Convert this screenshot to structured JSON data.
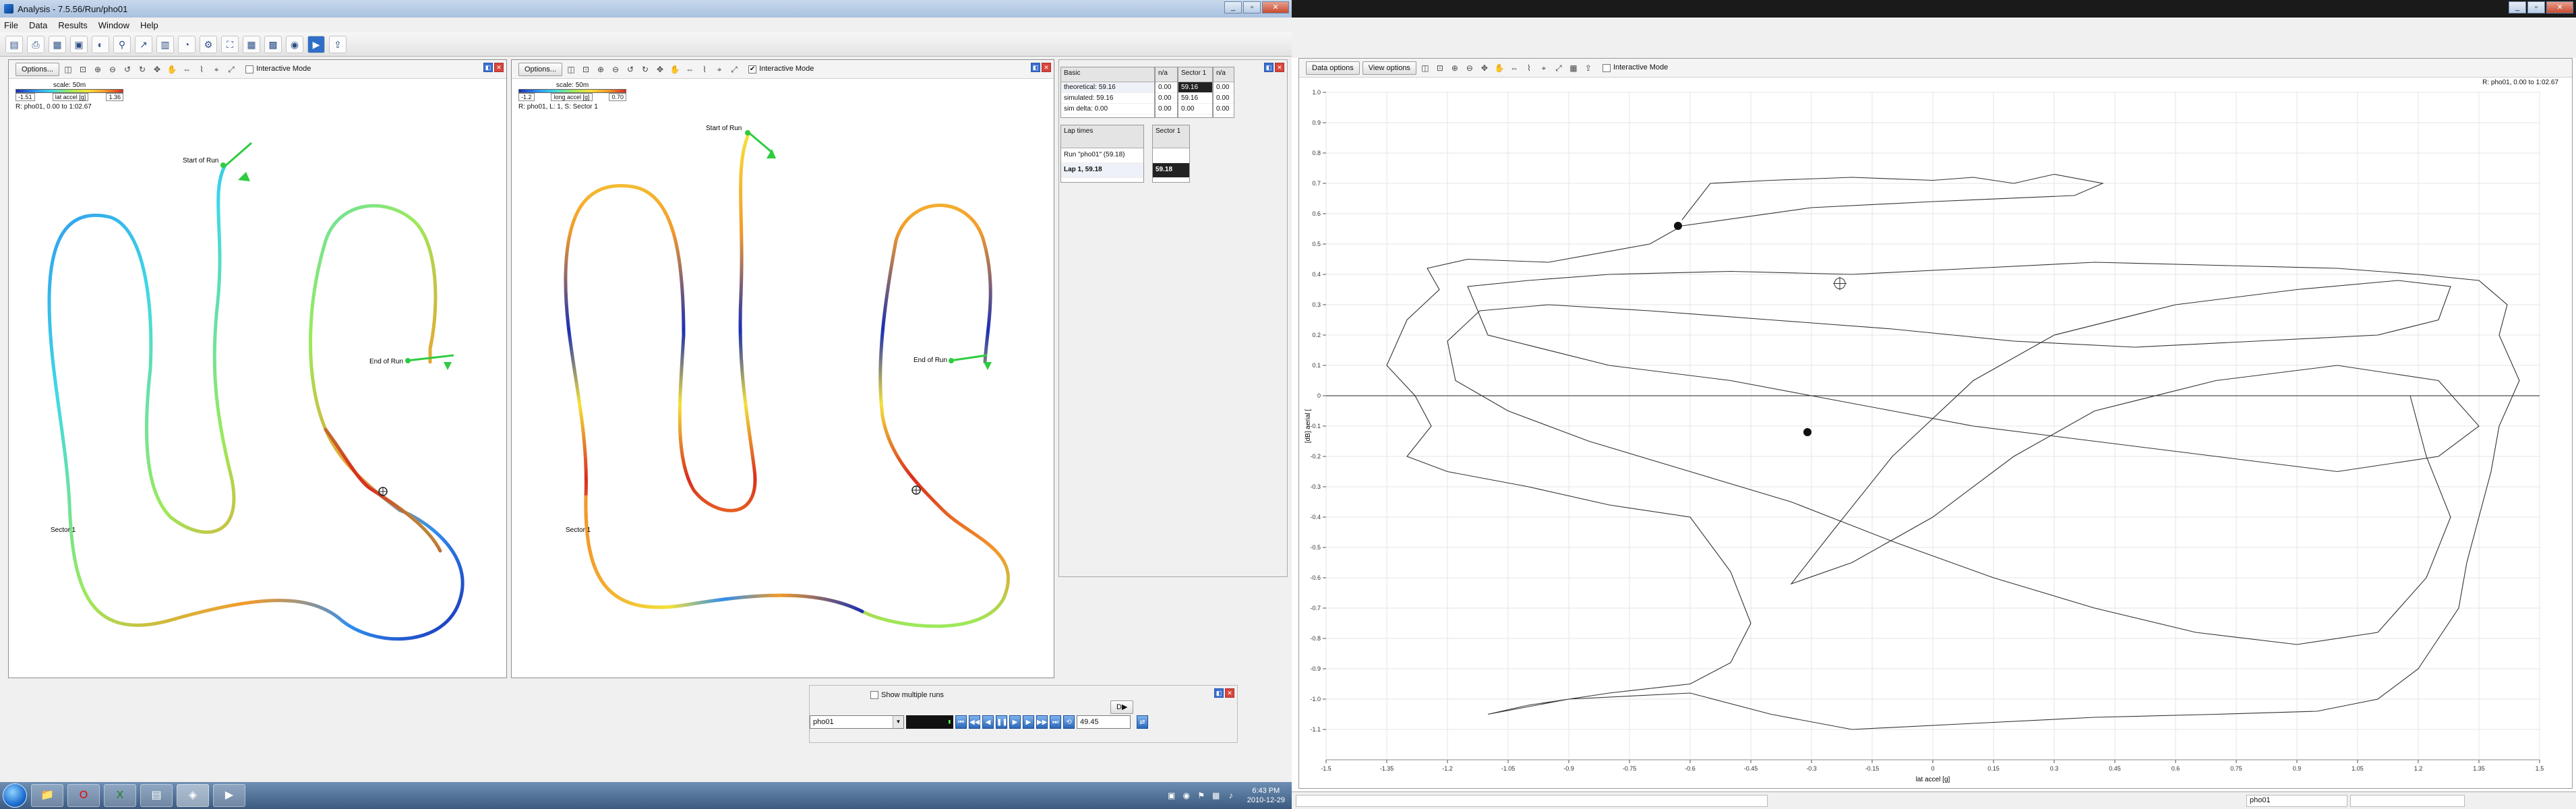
{
  "app": {
    "title": "Analysis - 7.5.56/Run/pho01",
    "menu": [
      "File",
      "Data",
      "Results",
      "Window",
      "Help"
    ]
  },
  "track_left": {
    "options_label": "Options...",
    "interactive_label": "Interactive Mode",
    "interactive_checked": false,
    "scale": "scale: 50m",
    "legend_min": "-1.51",
    "legend_channel": "lat accel [g]",
    "legend_max": "1.36",
    "info": "R: pho01, 0.00 to 1:02.67",
    "start_label": "Start of Run",
    "end_label": "End of Run",
    "sector_label": "Sector 1"
  },
  "track_mid": {
    "options_label": "Options...",
    "interactive_label": "Interactive Mode",
    "interactive_checked": true,
    "scale": "scale: 50m",
    "legend_min": "-1.2",
    "legend_channel": "long accel [g]",
    "legend_max": "0.70",
    "info": "R: pho01, L: 1, S: Sector 1",
    "start_label": "Start of Run",
    "end_label": "End of Run",
    "sector_label": "Sector 1"
  },
  "sectors_table": {
    "col_basic": "Basic",
    "col_nb": "n/a",
    "col_sector": "Sector 1",
    "col_nb2": "n/a",
    "rows": [
      {
        "label": "theoretical: 59.16",
        "nb": "0.00",
        "val": "59.16",
        "nb2": "0.00"
      },
      {
        "label": "simulated: 59.16",
        "nb": "0.00",
        "val": "59.16",
        "nb2": "0.00"
      },
      {
        "label": "sim delta: 0.00",
        "nb": "0.00",
        "val": "0.00",
        "nb2": "0.00"
      }
    ]
  },
  "laps_table": {
    "col_laps": "Lap times",
    "col_sector": "Sector 1",
    "run_label": "Run \"pho01\" (59.18)",
    "lap_label": "Lap 1, 59.18",
    "lap_sector": "59.18"
  },
  "playback": {
    "show_multiple_label": "Show multiple runs",
    "run_select": "pho01",
    "time": "49.45",
    "dp_label": "D▶"
  },
  "taskbar": {
    "time": "6:43 PM",
    "date": "2010-12-29"
  },
  "scatter_window": {
    "data_options_label": "Data options",
    "view_options_label": "View options",
    "interactive_label": "Interactive Mode",
    "info": "R: pho01, 0.00 to 1:02.67",
    "x_label": "lat accel [g]",
    "y_label": "[dB] aerial ["
  },
  "chart_data": {
    "type": "scatter",
    "x_label": "lat accel [g]",
    "y_label": "[dB] aerial [",
    "xlim": [
      -1.5,
      1.5
    ],
    "ylim": [
      -1.2,
      1.0
    ],
    "x_ticks": [
      "-1.5",
      "-1.35",
      "-1.2",
      "-1.05",
      "-0.9",
      "-0.75",
      "-0.6",
      "-0.45",
      "-0.3",
      "-0.15",
      "0",
      "0.15",
      "0.3",
      "0.45",
      "0.6",
      "0.75",
      "0.9",
      "1.05",
      "1.2",
      "1.35",
      "1.5"
    ],
    "y_ticks": [
      "1.0",
      "0.9",
      "0.8",
      "0.7",
      "0.6",
      "0.5",
      "0.4",
      "0.3",
      "0.2",
      "0.1",
      "0",
      "-0.1",
      "-0.2",
      "-0.3",
      "-0.4",
      "-0.5",
      "-0.6",
      "-0.7",
      "-0.8",
      "-0.9",
      "-1.0",
      "-1.1"
    ],
    "markers": [
      {
        "x": -0.63,
        "y": 0.56
      },
      {
        "x": -0.31,
        "y": -0.12
      }
    ],
    "cursor": {
      "x": -0.23,
      "y": 0.37
    },
    "trace": [
      [
        -0.62,
        0.58
      ],
      [
        -0.55,
        0.7
      ],
      [
        -0.4,
        0.71
      ],
      [
        -0.2,
        0.72
      ],
      [
        0.0,
        0.71
      ],
      [
        0.1,
        0.72
      ],
      [
        0.2,
        0.7
      ],
      [
        0.3,
        0.73
      ],
      [
        0.42,
        0.7
      ],
      [
        0.35,
        0.66
      ],
      [
        0.0,
        0.64
      ],
      [
        -0.3,
        0.62
      ],
      [
        -0.62,
        0.56
      ],
      [
        -0.7,
        0.5
      ],
      [
        -0.95,
        0.44
      ],
      [
        -1.15,
        0.45
      ],
      [
        -1.25,
        0.42
      ],
      [
        -1.22,
        0.35
      ],
      [
        -1.3,
        0.25
      ],
      [
        -1.35,
        0.1
      ],
      [
        -1.28,
        0.0
      ],
      [
        -1.24,
        -0.1
      ],
      [
        -1.3,
        -0.2
      ],
      [
        -1.2,
        -0.25
      ],
      [
        -1.0,
        -0.3
      ],
      [
        -0.8,
        -0.36
      ],
      [
        -0.6,
        -0.4
      ],
      [
        -0.5,
        -0.58
      ],
      [
        -0.45,
        -0.75
      ],
      [
        -0.5,
        -0.88
      ],
      [
        -0.6,
        -0.95
      ],
      [
        -0.8,
        -0.98
      ],
      [
        -1.0,
        -1.02
      ],
      [
        -1.1,
        -1.05
      ],
      [
        -0.9,
        -1.0
      ],
      [
        -0.6,
        -0.98
      ],
      [
        -0.4,
        -1.05
      ],
      [
        -0.2,
        -1.1
      ],
      [
        0.1,
        -1.08
      ],
      [
        0.4,
        -1.06
      ],
      [
        0.7,
        -1.05
      ],
      [
        0.95,
        -1.04
      ],
      [
        1.1,
        -1.0
      ],
      [
        1.2,
        -0.9
      ],
      [
        1.3,
        -0.7
      ],
      [
        1.32,
        -0.55
      ],
      [
        1.35,
        -0.4
      ],
      [
        1.38,
        -0.25
      ],
      [
        1.4,
        -0.1
      ],
      [
        1.45,
        0.05
      ],
      [
        1.4,
        0.2
      ],
      [
        1.42,
        0.3
      ],
      [
        1.35,
        0.38
      ],
      [
        1.2,
        0.4
      ],
      [
        1.0,
        0.42
      ],
      [
        0.7,
        0.43
      ],
      [
        0.4,
        0.44
      ],
      [
        0.1,
        0.42
      ],
      [
        -0.2,
        0.4
      ],
      [
        -0.5,
        0.41
      ],
      [
        -0.8,
        0.4
      ],
      [
        -1.0,
        0.38
      ],
      [
        -1.15,
        0.36
      ],
      [
        -1.1,
        0.2
      ],
      [
        -0.8,
        0.1
      ],
      [
        -0.5,
        0.05
      ],
      [
        -0.3,
        0.0
      ],
      [
        -0.1,
        -0.05
      ],
      [
        0.1,
        -0.1
      ],
      [
        0.4,
        -0.15
      ],
      [
        0.7,
        -0.2
      ],
      [
        1.0,
        -0.25
      ],
      [
        1.25,
        -0.2
      ],
      [
        1.35,
        -0.1
      ],
      [
        1.25,
        0.05
      ],
      [
        1.0,
        0.1
      ],
      [
        0.7,
        0.05
      ],
      [
        0.4,
        -0.05
      ],
      [
        0.2,
        -0.2
      ],
      [
        0.0,
        -0.4
      ],
      [
        -0.2,
        -0.55
      ],
      [
        -0.35,
        -0.62
      ],
      [
        -0.25,
        -0.45
      ],
      [
        -0.1,
        -0.2
      ],
      [
        0.1,
        0.05
      ],
      [
        0.3,
        0.2
      ],
      [
        0.6,
        0.3
      ],
      [
        0.9,
        0.35
      ],
      [
        1.15,
        0.38
      ],
      [
        1.28,
        0.36
      ],
      [
        1.25,
        0.25
      ],
      [
        1.1,
        0.2
      ],
      [
        0.8,
        0.18
      ],
      [
        0.5,
        0.16
      ],
      [
        0.2,
        0.18
      ],
      [
        -0.1,
        0.22
      ],
      [
        -0.4,
        0.25
      ],
      [
        -0.7,
        0.28
      ],
      [
        -0.95,
        0.3
      ],
      [
        -1.12,
        0.28
      ],
      [
        -1.2,
        0.18
      ],
      [
        -1.18,
        0.05
      ],
      [
        -1.05,
        -0.05
      ],
      [
        -0.85,
        -0.15
      ],
      [
        -0.6,
        -0.25
      ],
      [
        -0.35,
        -0.35
      ],
      [
        -0.1,
        -0.48
      ],
      [
        0.15,
        -0.6
      ],
      [
        0.4,
        -0.7
      ],
      [
        0.65,
        -0.78
      ],
      [
        0.9,
        -0.82
      ],
      [
        1.1,
        -0.78
      ],
      [
        1.22,
        -0.6
      ],
      [
        1.28,
        -0.4
      ],
      [
        1.22,
        -0.2
      ],
      [
        1.18,
        0.0
      ]
    ]
  }
}
